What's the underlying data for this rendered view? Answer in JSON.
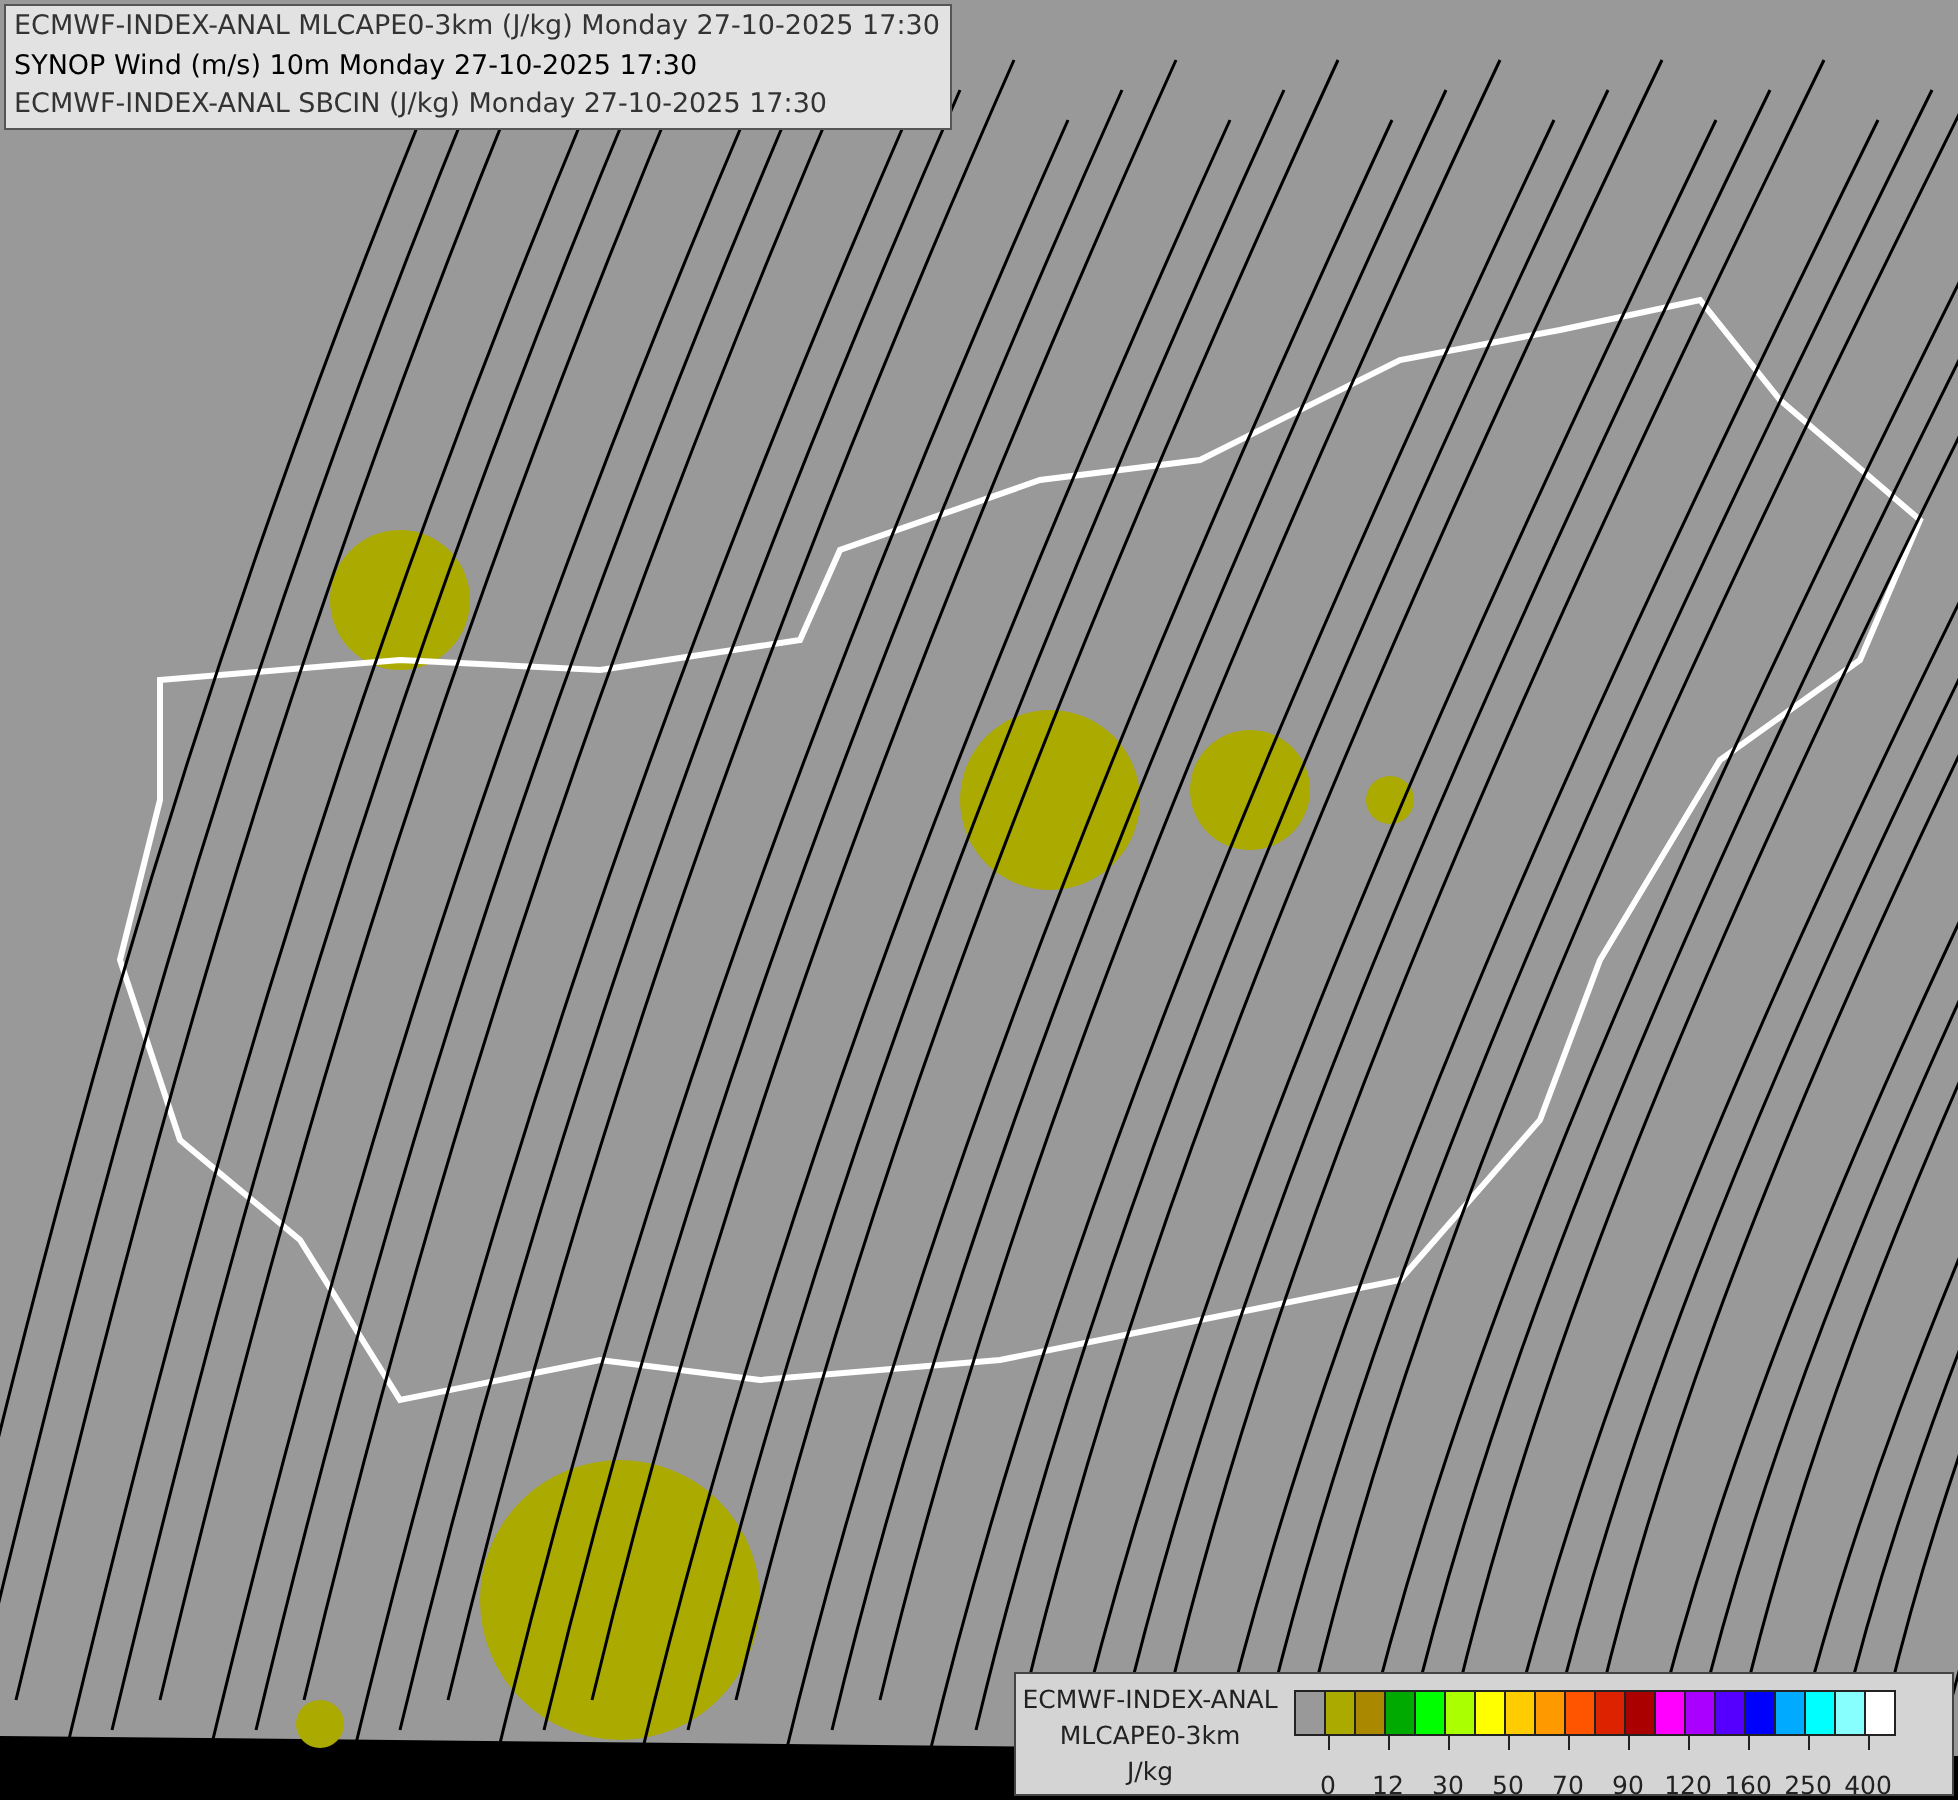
{
  "header": {
    "lines": [
      "ECMWF-INDEX-ANAL MLCAPE0-3km (J/kg) Monday 27-10-2025 17:30",
      "SYNOP Wind (m/s) 10m Monday 27-10-2025 17:30",
      "ECMWF-INDEX-ANAL SBCIN (J/kg) Monday 27-10-2025 17:30"
    ]
  },
  "legend": {
    "title_lines": [
      "ECMWF-INDEX-ANAL",
      "MLCAPE0-3km",
      "J/kg"
    ],
    "swatches": [
      {
        "color": "#999999"
      },
      {
        "color": "#aaaa00"
      },
      {
        "color": "#aa8800"
      },
      {
        "color": "#00aa00"
      },
      {
        "color": "#00ff00"
      },
      {
        "color": "#aaff00"
      },
      {
        "color": "#ffff00"
      },
      {
        "color": "#ffcc00"
      },
      {
        "color": "#ff9900"
      },
      {
        "color": "#ff5500"
      },
      {
        "color": "#dd2200"
      },
      {
        "color": "#aa0000"
      },
      {
        "color": "#ff00ff"
      },
      {
        "color": "#aa00ff"
      },
      {
        "color": "#5500ff"
      },
      {
        "color": "#0000ff"
      },
      {
        "color": "#00aaff"
      },
      {
        "color": "#00ffff"
      },
      {
        "color": "#88ffff"
      },
      {
        "color": "#ffffff"
      }
    ],
    "ticks": [
      "0",
      "12",
      "30",
      "50",
      "70",
      "90",
      "120",
      "160",
      "250",
      "400"
    ]
  }
}
